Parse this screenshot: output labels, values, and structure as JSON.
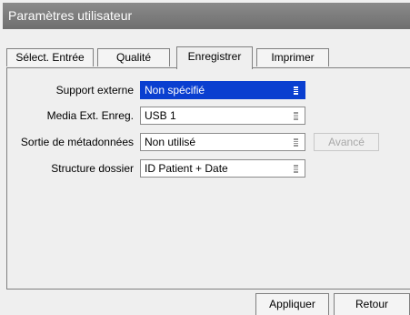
{
  "window": {
    "title": "Paramètres utilisateur"
  },
  "tabs": [
    {
      "label": "Sélect. Entrée",
      "active": false
    },
    {
      "label": "Qualité",
      "active": false
    },
    {
      "label": "Enregistrer",
      "active": true
    },
    {
      "label": "Imprimer",
      "active": false
    }
  ],
  "fields": [
    {
      "label": "Support externe",
      "value": "Non spécifié",
      "selected": true
    },
    {
      "label": "Media Ext. Enreg.",
      "value": "USB 1",
      "selected": false
    },
    {
      "label": "Sortie de métadonnées",
      "value": "Non utilisé",
      "selected": false
    },
    {
      "label": "Structure dossier",
      "value": "ID Patient + Date",
      "selected": false
    }
  ],
  "advanced_button": {
    "label": "Avancé",
    "enabled": false
  },
  "footer": {
    "apply_label": "Appliquer",
    "back_label": "Retour"
  },
  "colors": {
    "titlebar": "#7a7a7a",
    "selection": "#0a3fd0",
    "panel": "#efefef"
  }
}
